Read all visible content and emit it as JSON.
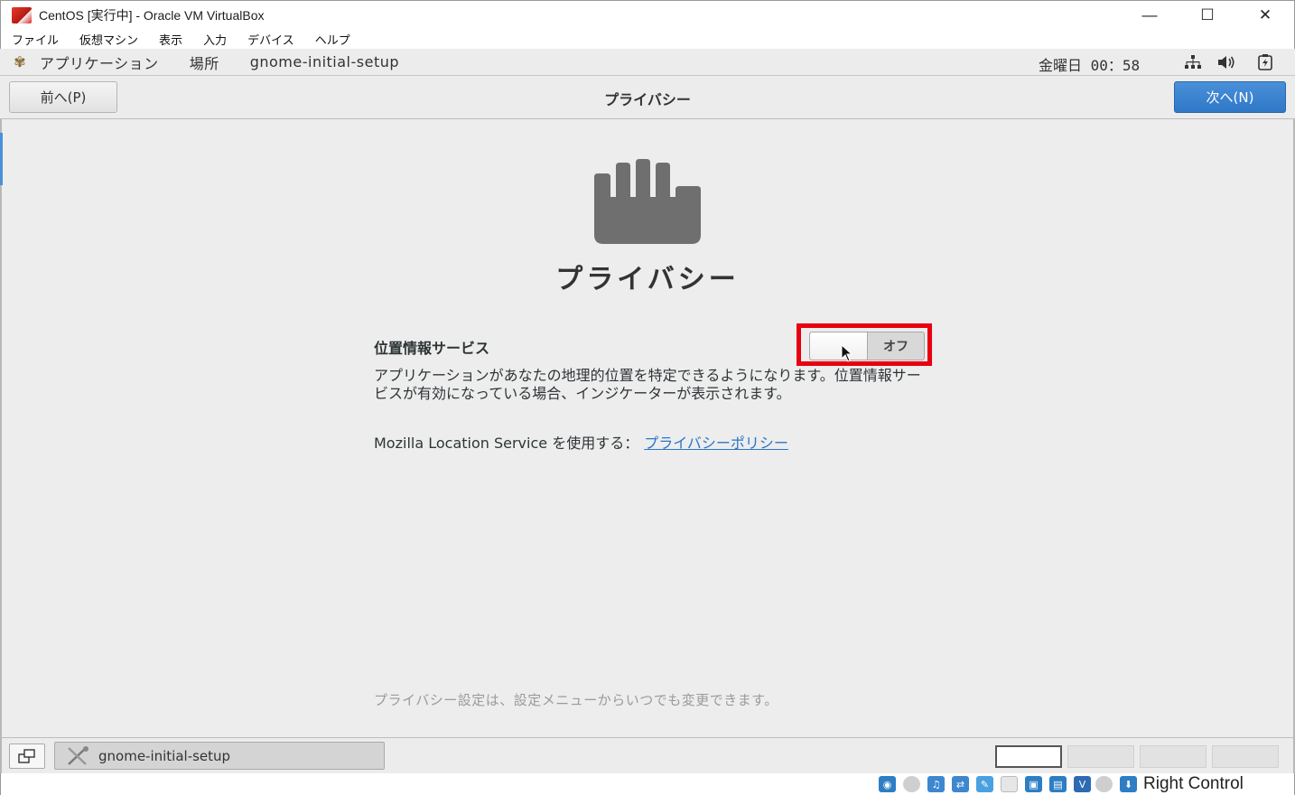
{
  "window": {
    "title": "CentOS [実行中] - Oracle VM VirtualBox",
    "min": "—",
    "max": "☐",
    "close": "✕"
  },
  "menubar": [
    "ファイル",
    "仮想マシン",
    "表示",
    "入力",
    "デバイス",
    "ヘルプ"
  ],
  "panel": {
    "applications": "アプリケーション",
    "places": "場所",
    "app_name": "gnome-initial-setup",
    "clock": "金曜日 00：58",
    "icons": [
      "network-icon",
      "volume-icon",
      "power-icon"
    ]
  },
  "header": {
    "prev": "前へ(P)",
    "title": "プライバシー",
    "next": "次へ(N)"
  },
  "page": {
    "title": "プライバシー",
    "location_label": "位置情報サービス",
    "toggle_state": "オフ",
    "description": "アプリケーションがあなたの地理的位置を特定できるようになります。位置情報サービスが有効になっている場合、インジケーターが表示されます。",
    "mls_text": "Mozilla Location Service を使用する：",
    "policy_link": "プライバシーポリシー",
    "footer_note": "プライバシー設定は、設定メニューからいつでも変更できます。"
  },
  "taskbar": {
    "task_label": "gnome-initial-setup",
    "workspaces": 4,
    "active_workspace": 1
  },
  "vbox_status": {
    "host_key": "Right Control"
  },
  "colors": {
    "accent": "#4a90d9",
    "highlight": "#e8000f",
    "link": "#2a76c6"
  }
}
